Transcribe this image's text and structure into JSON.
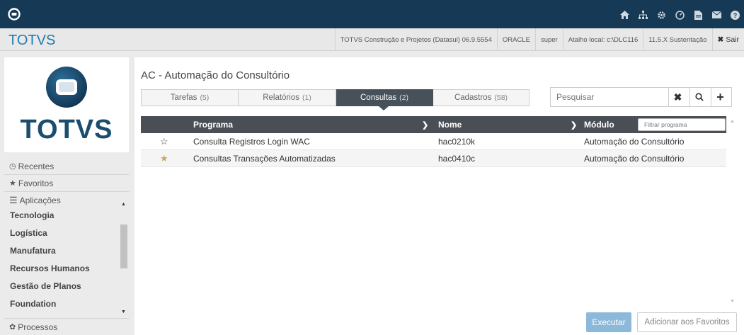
{
  "topbar": {
    "icons": [
      "home-icon",
      "sitemap-icon",
      "gear-icon",
      "dashboard-icon",
      "document-icon",
      "mail-icon",
      "help-icon"
    ],
    "color": "#163a56"
  },
  "header": {
    "brand": "TOTVS",
    "info": [
      "TOTVS Construção e Projetos (Datasul) 06.9.5554",
      "ORACLE",
      "super",
      "Atalho local: c:\\DLC116",
      "11.5.X Sustentação",
      "Sair"
    ]
  },
  "sidebar": {
    "logo_text": "TOTVS",
    "recentes": "Recentes",
    "favoritos": "Favoritos",
    "aplicacoes": "Aplicações",
    "apps": [
      "Tecnologia",
      "Logística",
      "Manufatura",
      "Recursos Humanos",
      "Gestão de Planos",
      "Foundation"
    ],
    "processos": "Processos"
  },
  "main": {
    "title": "AC - Automação do Consultório",
    "tabs": [
      {
        "label": "Tarefas",
        "count": "(5)"
      },
      {
        "label": "Relatórios",
        "count": "(1)"
      },
      {
        "label": "Consultas",
        "count": "(2)"
      },
      {
        "label": "Cadastros",
        "count": "(58)"
      }
    ],
    "search_placeholder": "Pesquisar",
    "columns": {
      "programa": "Programa",
      "nome": "Nome",
      "modulo": "Módulo"
    },
    "filter_placeholder": "Filtrar programa",
    "rows": [
      {
        "favorite": "☆",
        "programa": "Consulta Registros Login WAC",
        "nome": "hac0210k",
        "modulo": "Automação do Consultório"
      },
      {
        "favorite": "★",
        "programa": "Consultas Transações Automatizadas",
        "nome": "hac0410c",
        "modulo": "Automação do Consultório"
      }
    ],
    "buttons": {
      "executar": "Executar",
      "adicionar": "Adicionar aos Favoritos"
    }
  },
  "colors": {
    "accent": "#1f7bb3",
    "tab_active": "#47515a",
    "table_header": "#4a4f55",
    "button_primary": "#8cb8da",
    "star_filled": "#c8a56a"
  }
}
